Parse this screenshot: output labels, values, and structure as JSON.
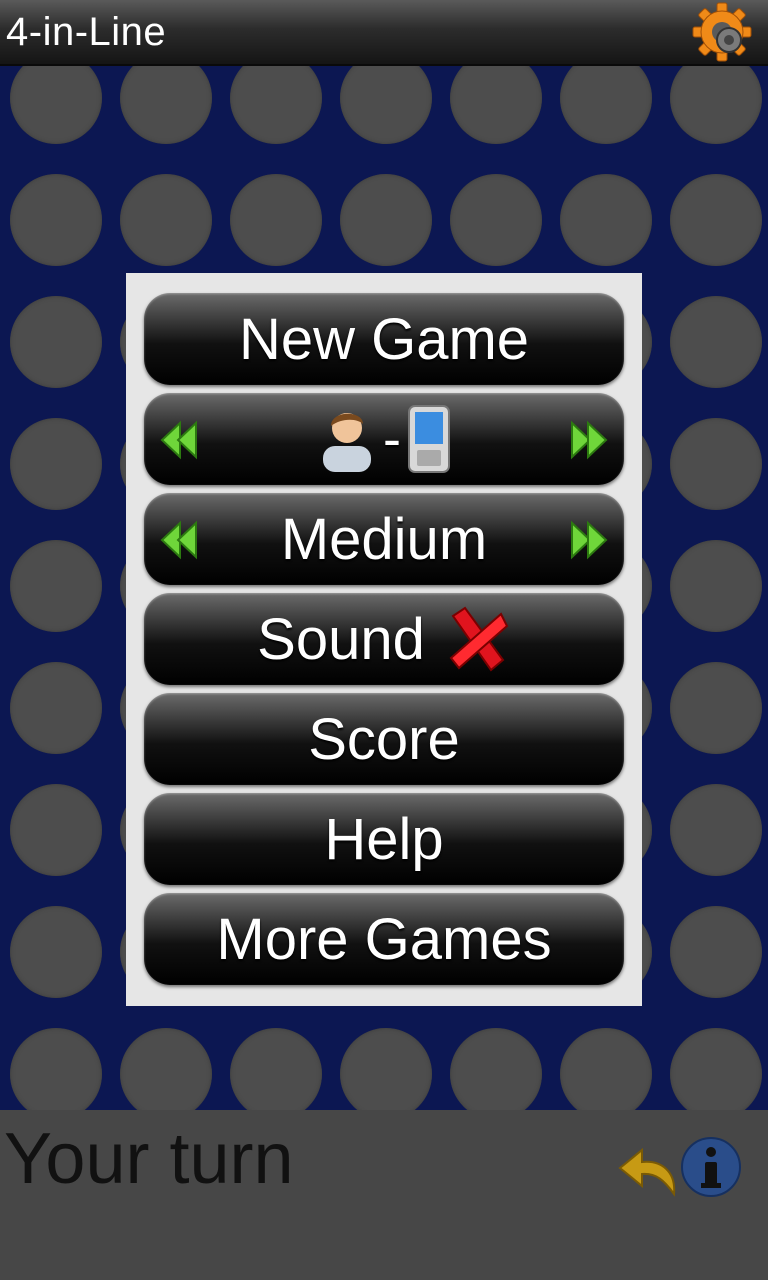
{
  "app": {
    "title": "4-in-Line"
  },
  "menu": {
    "new_game": "New Game",
    "mode": {
      "player1_icon": "person-icon",
      "separator": "-",
      "player2_icon": "phone-icon"
    },
    "difficulty": "Medium",
    "sound": {
      "label": "Sound",
      "state_icon": "red-x-icon"
    },
    "score": "Score",
    "help": "Help",
    "more_games": "More Games"
  },
  "status": {
    "turn_text": "Your turn"
  },
  "colors": {
    "board": "#0c1752",
    "hole": "#4d4d4d",
    "arrow": "#6fd63a",
    "menu_bg": "#e6e6e6"
  }
}
